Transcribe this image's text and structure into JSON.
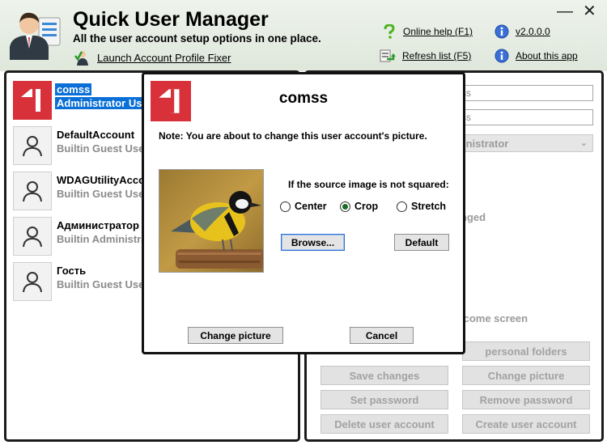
{
  "app": {
    "title": "Quick User Manager",
    "subtitle": "All the user account setup options in one place.",
    "fixer_link": "Launch Account Profile Fixer",
    "help_link": "Online help (F1)",
    "version_link": "v2.0.0.0",
    "refresh_link": "Refresh list (F5)",
    "about_link": "About this app",
    "minimize_glyph": "—",
    "close_glyph": "✕"
  },
  "users": [
    {
      "name": "comss",
      "role": "Administrator Use",
      "avatar": "brand-logo",
      "selected": true
    },
    {
      "name": "DefaultAccount",
      "role": "Builtin Guest Use",
      "avatar": "user-icon",
      "selected": false
    },
    {
      "name": "WDAGUtilityAcco",
      "role": "Builtin Guest Use",
      "avatar": "user-icon",
      "selected": false
    },
    {
      "name": "Администратор",
      "role": "Builtin Administrat",
      "avatar": "user-icon",
      "selected": false
    },
    {
      "name": "Гость",
      "role": "Builtin Guest Use",
      "avatar": "user-icon",
      "selected": false
    }
  ],
  "details": {
    "field1_value": "ss",
    "field2_value": "ss",
    "account_type": "inistrator",
    "ghost_text_1": "nged",
    "ghost_text_2": "lcome screen",
    "buttons": {
      "personal_folders": "personal folders",
      "save_changes": "Save changes",
      "change_picture": "Change picture",
      "set_password": "Set password",
      "remove_password": "Remove password",
      "delete_user": "Delete user account",
      "create_user": "Create user account"
    }
  },
  "dialog": {
    "title": "comss",
    "note": "Note: You are about to change this user account's picture.",
    "question": "If the source image is not squared:",
    "options": [
      "Center",
      "Crop",
      "Stretch"
    ],
    "selected_option": "Crop",
    "browse_label": "Browse...",
    "default_label": "Default",
    "change_label": "Change picture",
    "cancel_label": "Cancel"
  },
  "colors": {
    "brand_red": "#d8313a",
    "selection_blue": "#0a6fd6",
    "header_bg": "#e4ebe0"
  }
}
